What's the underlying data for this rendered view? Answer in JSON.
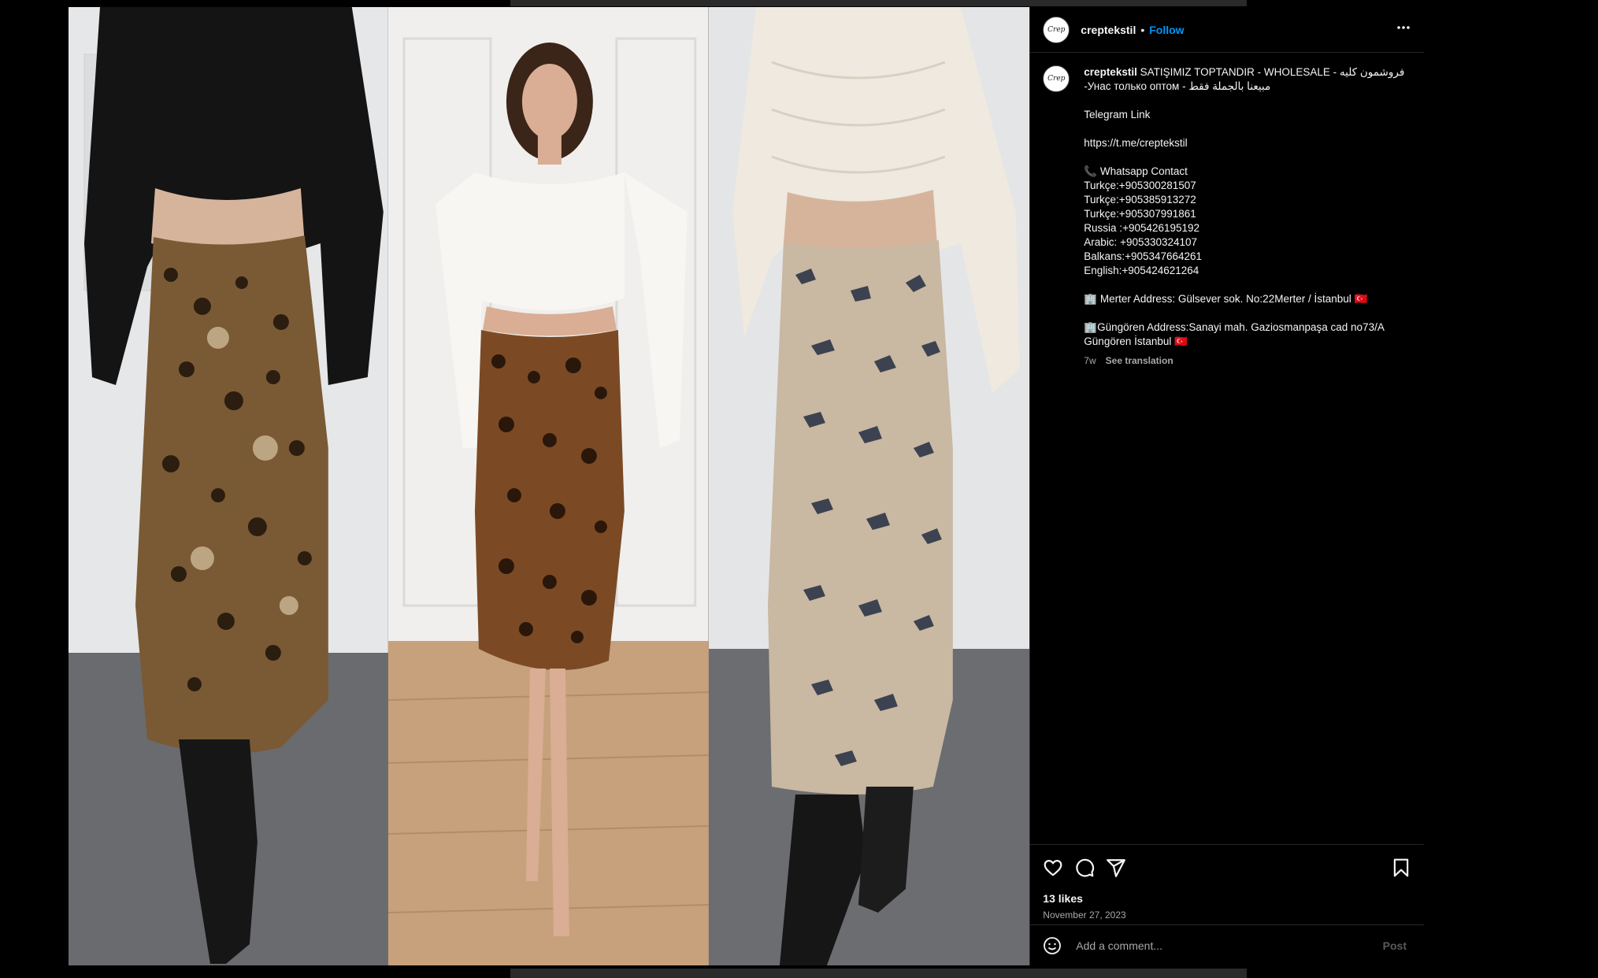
{
  "post": {
    "username": "creptekstil",
    "avatar_text": "Crep",
    "separator": "•",
    "follow_label": "Follow",
    "more_label": "•••"
  },
  "caption": {
    "username": "creptekstil",
    "first_line": " SATIŞIMIZ TOPTANDIR - WHOLESALE - فروشمون کلیه",
    "lines": [
      "-Унас только оптом - مبيعنا بالجملة فقط",
      "",
      "Telegram Link",
      "",
      "https://t.me/creptekstil",
      "",
      "📞 Whatsapp Contact",
      "Turkçe:+905300281507",
      "Turkçe:+905385913272",
      "Turkçe:+905307991861",
      "Russia :+905426195192",
      "Arabic: +905330324107",
      "Balkans:+905347664261",
      "English:+905424621264",
      "",
      "🏢 Merter Address: Gülsever sok. No:22Merter / İstanbul 🇹🇷",
      "",
      "🏢Güngören Address:Sanayi mah. Gaziosmanpaşa cad no73/A Güngören İstanbul 🇹🇷"
    ],
    "time_ago": "7w",
    "see_translation": "See translation"
  },
  "engagement": {
    "likes": "13 likes",
    "date": "November 27, 2023"
  },
  "comment": {
    "placeholder": "Add a comment...",
    "post_label": "Post"
  },
  "icons": {
    "like": "heart-icon",
    "comment": "comment-icon",
    "share": "share-icon",
    "save": "bookmark-icon",
    "emoji": "emoji-icon"
  },
  "colors": {
    "accent": "#0095f6",
    "background": "#000000",
    "border": "#262626",
    "muted": "#a8a8a8"
  }
}
